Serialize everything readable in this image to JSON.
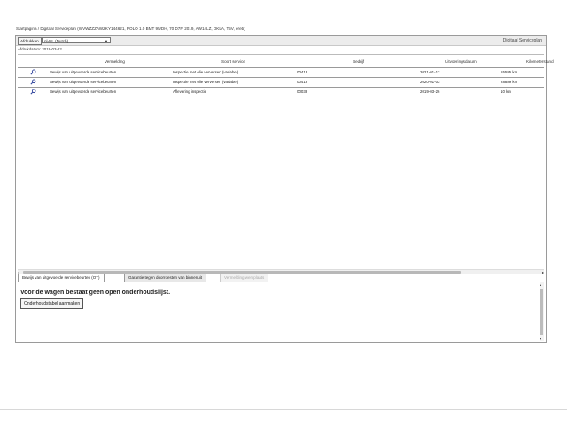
{
  "breadcrumb": "Startpagina / Digitaal Serviceplan (WVWZZZAWZKY144621, POLO 1.0 BMT 95/DH, 70 D7F, 2019, AW14LZ, DKLA, T5V, ereb)",
  "toolbar": {
    "print_label": "Afdrukken",
    "language": "nl-NL (Dutch)",
    "app_title": "Digitaal Serviceplan"
  },
  "print_date": "Afdrukdatum: 2019-03-22",
  "table": {
    "columns": [
      "Vermelding",
      "Soort service",
      "Bedrijf",
      "Uitvoeringsdatum",
      "Kilometerstand"
    ],
    "rows": [
      [
        "Bewijs van uitgevoerde servicebeurten",
        "Inspectie met olie verversen (variabel)",
        "00419",
        "2021-01-12",
        "55585 km"
      ],
      [
        "Bewijs van uitgevoerde servicebeurten",
        "Inspectie met olie verversen (variabel)",
        "00419",
        "2020-01-03",
        "28889 km"
      ],
      [
        "Bewijs van uitgevoerde servicebeurten",
        "Aflevering inspectie",
        "00038",
        "2019-03-26",
        "10 km"
      ]
    ]
  },
  "tabs": [
    {
      "label": "Bewijs van uitgevoerde servicebeurten (OT)",
      "state": "active"
    },
    {
      "label": "Garantie tegen doorroesten van binnenuit",
      "state": "normal"
    },
    {
      "label": "Vermelding werkplaats",
      "state": "disabled"
    }
  ],
  "panel": {
    "notice": "Voor de wagen bestaat geen open onderhoudslijst.",
    "create_button": "Onderhoudstabel aanmaken"
  },
  "icons": {
    "view": "magnifier-icon"
  }
}
